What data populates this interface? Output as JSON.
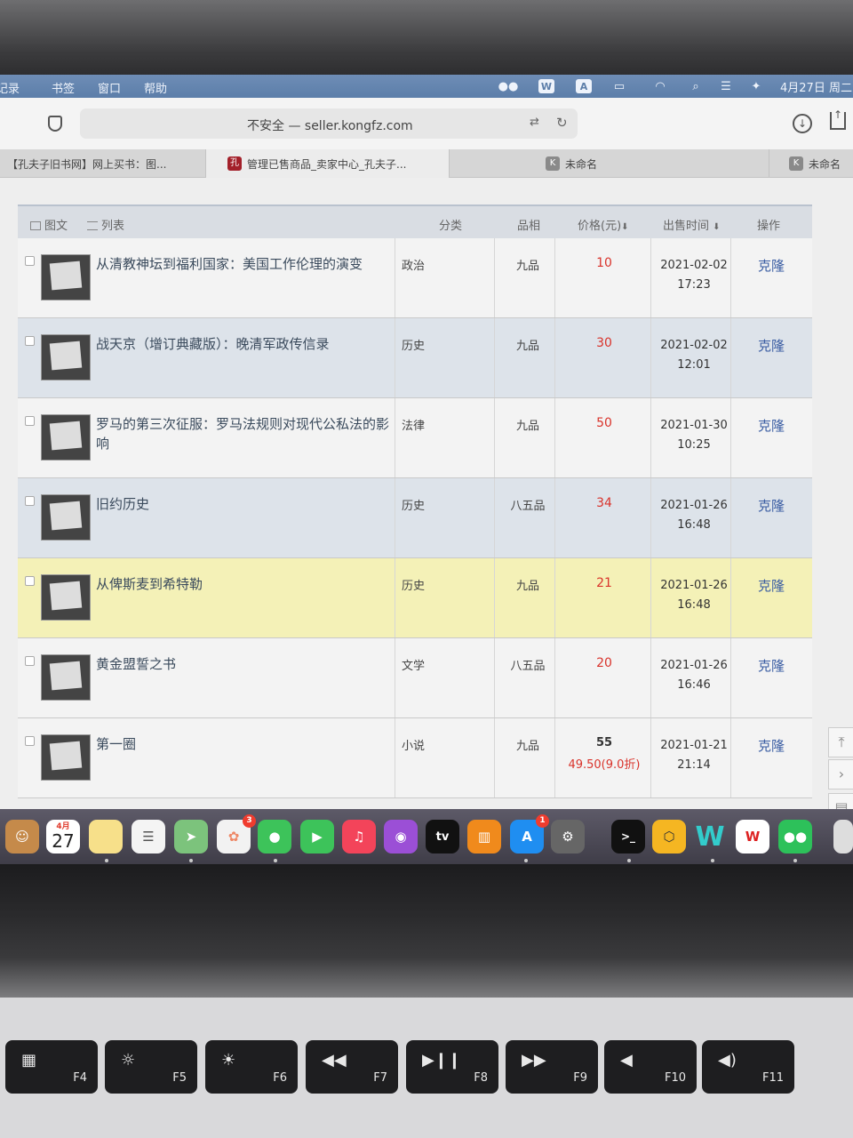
{
  "menubar": {
    "items": [
      "记录",
      "书签",
      "窗口",
      "帮助"
    ],
    "clock": "4月27日 周二",
    "status_icons": [
      "wechat-icon",
      "wps-icon",
      "input-method-icon",
      "battery-icon",
      "wifi-icon",
      "search-icon",
      "control-center-icon",
      "siri-icon"
    ]
  },
  "browser": {
    "url": "不安全 — seller.kongfz.com",
    "tabs": [
      {
        "label": "【孔夫子旧书网】网上买书：图...",
        "fav": ""
      },
      {
        "label": "管理已售商品_卖家中心_孔夫子...",
        "fav": "孔"
      },
      {
        "label": "未命名",
        "fav": "K"
      },
      {
        "label": "未命名",
        "fav": "K"
      }
    ]
  },
  "table": {
    "view_grid": "图文",
    "view_list": "列表",
    "headers": {
      "category": "分类",
      "condition": "品相",
      "price": "价格(元)",
      "sold_time": "出售时间",
      "action": "操作"
    },
    "sort_arrow": "⬇",
    "rows": [
      {
        "title": "从清教神坛到福利国家：美国工作伦理的演变",
        "category": "政治",
        "condition": "九品",
        "price": "10",
        "date": "2021-02-02",
        "time": "17:23",
        "action": "克隆"
      },
      {
        "title": "战天京（增订典藏版）：晚清军政传信录",
        "category": "历史",
        "condition": "九品",
        "price": "30",
        "date": "2021-02-02",
        "time": "12:01",
        "action": "克隆"
      },
      {
        "title": "罗马的第三次征服：罗马法规则对现代公私法的影响",
        "category": "法律",
        "condition": "九品",
        "price": "50",
        "date": "2021-01-30",
        "time": "10:25",
        "action": "克隆"
      },
      {
        "title": "旧约历史",
        "category": "历史",
        "condition": "八五品",
        "price": "34",
        "date": "2021-01-26",
        "time": "16:48",
        "action": "克隆"
      },
      {
        "title": "从俾斯麦到希特勒",
        "category": "历史",
        "condition": "九品",
        "price": "21",
        "date": "2021-01-26",
        "time": "16:48",
        "action": "克隆"
      },
      {
        "title": "黄金盟誓之书",
        "category": "文学",
        "condition": "八五品",
        "price": "20",
        "date": "2021-01-26",
        "time": "16:46",
        "action": "克隆"
      },
      {
        "title": "第一圈",
        "category": "小说",
        "condition": "九品",
        "price": "55",
        "discount": "49.50(9.0折)",
        "date": "2021-01-21",
        "time": "21:14",
        "action": "克隆"
      }
    ]
  },
  "dock": {
    "calendar_month": "4月",
    "calendar_day": "27",
    "tv_label": "tv",
    "photos_badge": "3",
    "appstore_badge": "1",
    "wps_label": "W"
  },
  "keyboard": {
    "keys": [
      {
        "sym": "▦",
        "label": "F4"
      },
      {
        "sym": "☼",
        "label": "F5"
      },
      {
        "sym": "☀",
        "label": "F6"
      },
      {
        "sym": "◀◀",
        "label": "F7"
      },
      {
        "sym": "▶❙❙",
        "label": "F8"
      },
      {
        "sym": "▶▶",
        "label": "F9"
      },
      {
        "sym": "◀",
        "label": "F10"
      },
      {
        "sym": "◀)",
        "label": "F11"
      }
    ]
  },
  "colors": {
    "price_red": "#d9332b",
    "link_blue": "#3a5da3",
    "highlight_row": "#f4f1b7"
  }
}
